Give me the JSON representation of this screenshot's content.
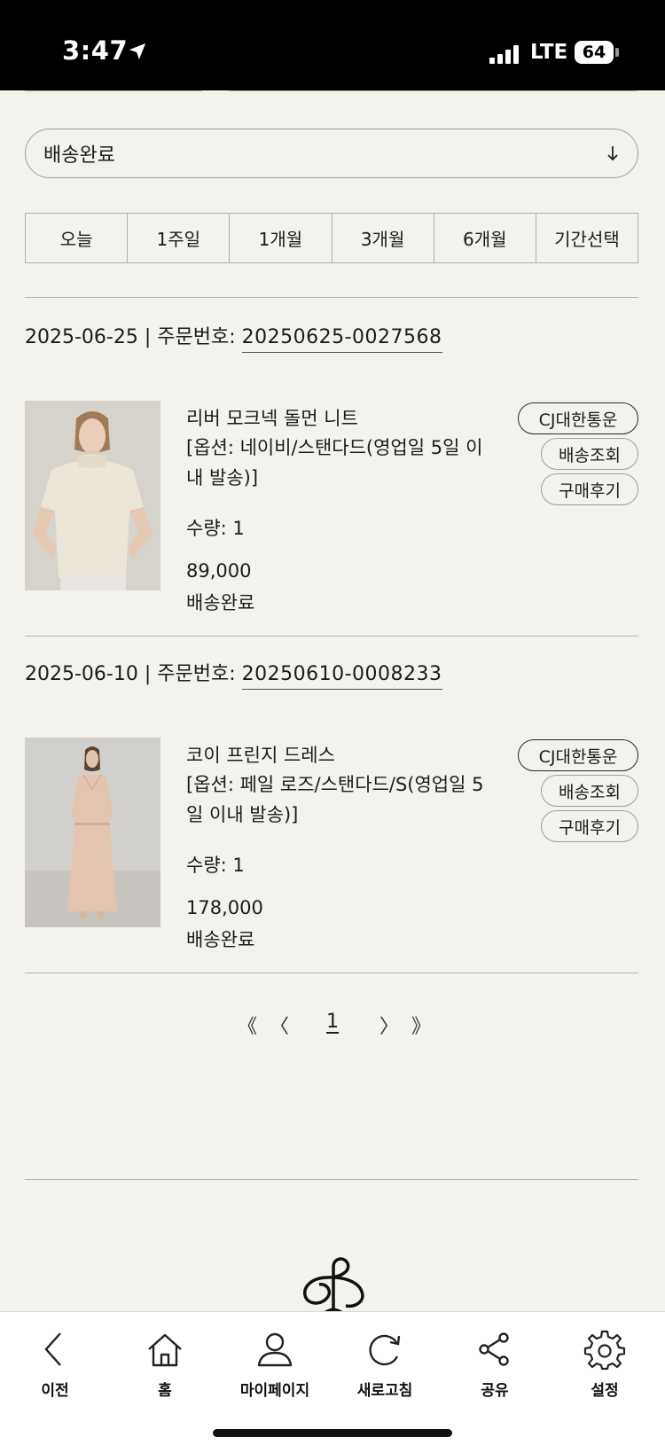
{
  "status_bar": {
    "time": "3:47",
    "network": "LTE",
    "battery": "64"
  },
  "filter": {
    "selected": "배송완료"
  },
  "period_tabs": [
    "오늘",
    "1주일",
    "1개월",
    "3개월",
    "6개월",
    "기간선택"
  ],
  "orders": [
    {
      "date_prefix": "2025-06-25 | 주문번호: ",
      "order_no": "20250625-0027568",
      "product_name": "리버 모크넥 돌먼 니트",
      "option": "[옵션: 네이비/스탠다드(영업일 5일 이내 발송)]",
      "qty": "수량: 1",
      "price": "89,000",
      "status": "배송완료",
      "courier": "CJ대한통운",
      "track_label": "배송조회",
      "review_label": "구매후기"
    },
    {
      "date_prefix": "2025-06-10 | 주문번호: ",
      "order_no": "20250610-0008233",
      "product_name": "코이 프린지 드레스",
      "option": "[옵션: 페일 로즈/스탠다드/S(영업일 5일 이내 발송)]",
      "qty": "수량: 1",
      "price": "178,000",
      "status": "배송완료",
      "courier": "CJ대한통운",
      "track_label": "배송조회",
      "review_label": "구매후기"
    }
  ],
  "pagination": {
    "first": "《",
    "prev": "〈",
    "current": "1",
    "next": "〉",
    "last": "》"
  },
  "bottom_nav": [
    {
      "label": "이전",
      "icon": "back-icon"
    },
    {
      "label": "홈",
      "icon": "home-icon"
    },
    {
      "label": "마이페이지",
      "icon": "user-icon"
    },
    {
      "label": "새로고침",
      "icon": "refresh-icon"
    },
    {
      "label": "공유",
      "icon": "share-icon"
    },
    {
      "label": "설정",
      "icon": "gear-icon"
    }
  ]
}
